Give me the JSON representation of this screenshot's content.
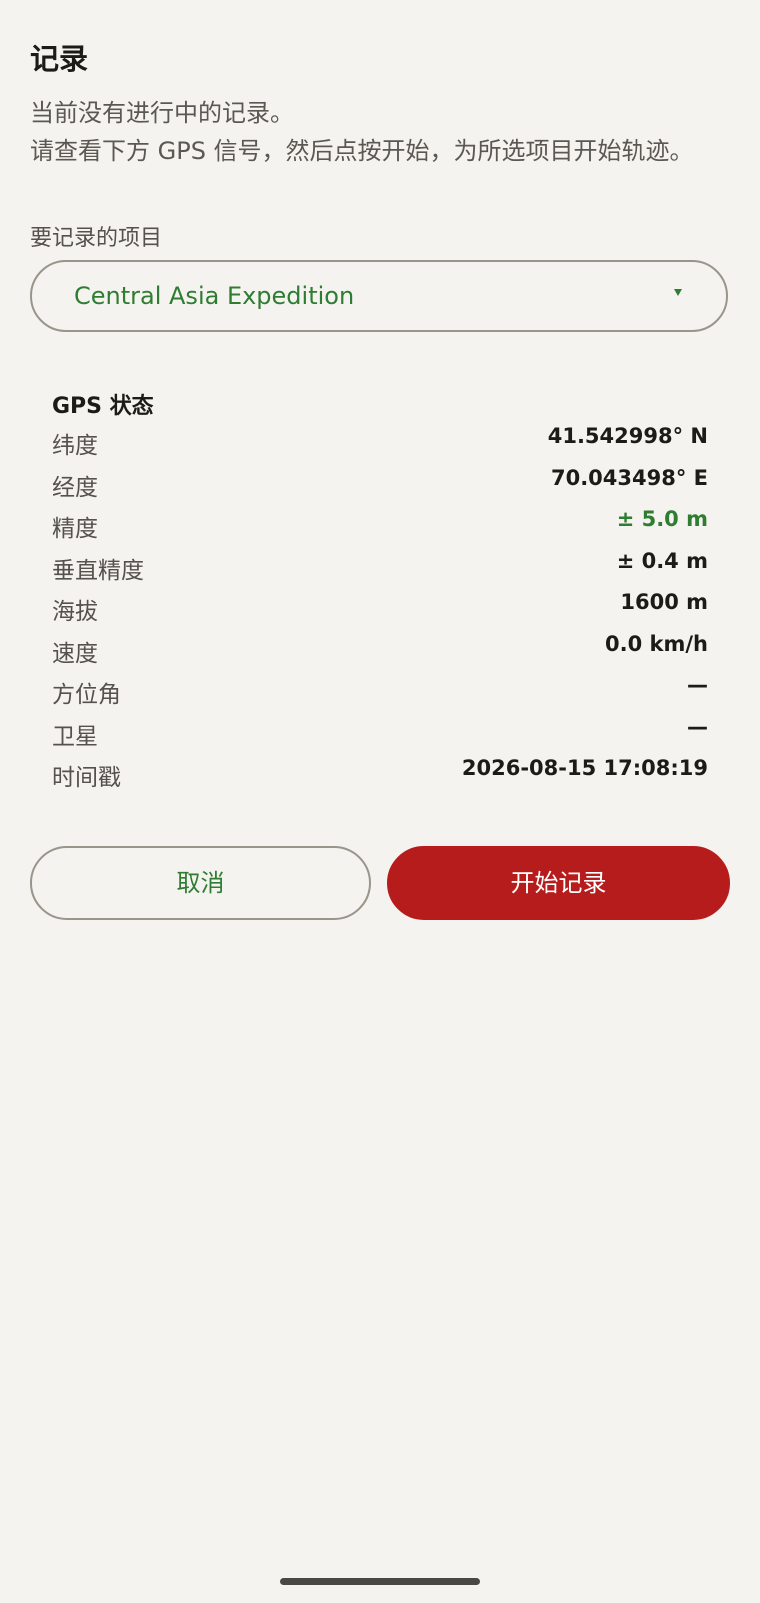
{
  "header": {
    "title": "记录"
  },
  "description": {
    "line1": "当前没有进行中的记录。",
    "line2": "请查看下方 GPS 信号，然后点按开始，为所选项目开始轨迹。"
  },
  "project": {
    "label": "要记录的项目",
    "selected": "Central Asia Expedition"
  },
  "gps": {
    "title": "GPS 状态",
    "rows": [
      {
        "label": "纬度",
        "value": "41.542998° N"
      },
      {
        "label": "经度",
        "value": "70.043498° E"
      },
      {
        "label": "精度",
        "value": "± 5.0 m"
      },
      {
        "label": "垂直精度",
        "value": "± 0.4 m"
      },
      {
        "label": "海拔",
        "value": "1600 m"
      },
      {
        "label": "速度",
        "value": "0.0 km/h"
      },
      {
        "label": "方位角",
        "value": "—"
      },
      {
        "label": "卫星",
        "value": "—"
      },
      {
        "label": "时间戳",
        "value": "2026-08-15 17:08:19"
      }
    ]
  },
  "actions": {
    "cancel_label": "取消",
    "start_label": "开始记录"
  },
  "colors": {
    "accent_green": "#2e7d32",
    "record_red": "#b71c1c",
    "background": "#f5f3ef"
  }
}
